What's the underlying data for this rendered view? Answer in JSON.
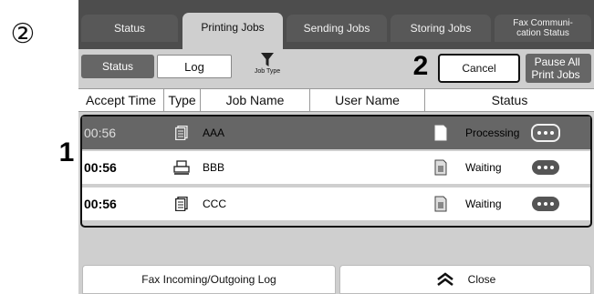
{
  "marker_circled": "②",
  "marker_1": "1",
  "marker_2": "2",
  "tabs": [
    {
      "label": "Status"
    },
    {
      "label": "Printing Jobs"
    },
    {
      "label": "Sending Jobs"
    },
    {
      "label": "Storing Jobs"
    },
    {
      "label": "Fax Communi-\ncation Status"
    }
  ],
  "active_tab": "Printing Jobs",
  "toolbar": {
    "status_label": "Status",
    "log_label": "Log",
    "job_type_label": "Job Type",
    "cancel_label": "Cancel",
    "pause_label": "Pause All\nPrint Jobs"
  },
  "columns": [
    "Accept Time",
    "Type",
    "Job Name",
    "User Name",
    "Status"
  ],
  "jobs": [
    {
      "time": "00:56",
      "type_icon": "copy-icon",
      "name": "AAA",
      "user": "",
      "status_icon": "document-icon",
      "status": "Processing",
      "selected": true
    },
    {
      "time": "00:56",
      "type_icon": "printer-icon",
      "name": "BBB",
      "user": "",
      "status_icon": "document-icon",
      "status": "Waiting",
      "selected": false
    },
    {
      "time": "00:56",
      "type_icon": "copy-icon",
      "name": "CCC",
      "user": "",
      "status_icon": "document-icon",
      "status": "Waiting",
      "selected": false
    }
  ],
  "bottom": {
    "fax_log_label": "Fax Incoming/Outgoing Log",
    "close_label": "Close"
  },
  "colors": {
    "dark_bar": "#4d4d4d",
    "panel": "#cfcfcf",
    "selected_row": "#666666"
  }
}
